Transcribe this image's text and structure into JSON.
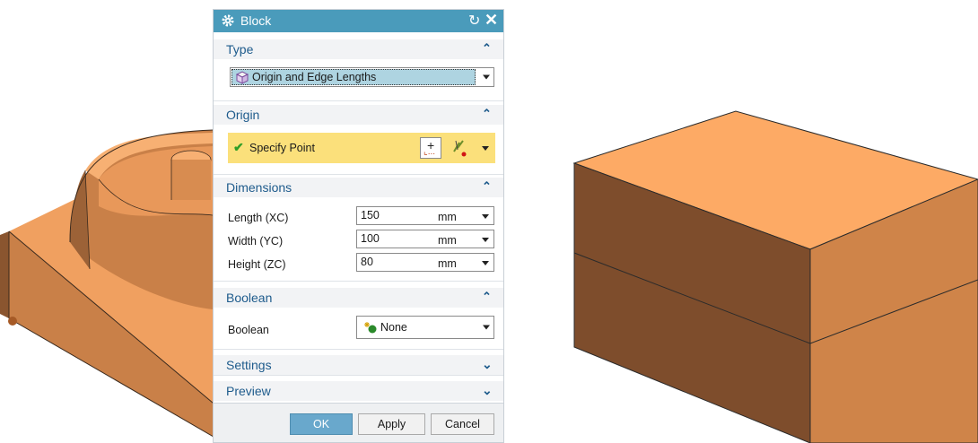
{
  "dialog": {
    "title": "Block",
    "icons": {
      "title": "gear-icon",
      "reset": "reset-icon",
      "close": "close-icon"
    },
    "type": {
      "header": "Type",
      "selected": "Origin and Edge Lengths",
      "icon": "block-icon"
    },
    "origin": {
      "header": "Origin",
      "specify": "Specify Point",
      "status_icon": "checkmark-icon"
    },
    "dimensions": {
      "header": "Dimensions",
      "rows": [
        {
          "label": "Length (XC)",
          "value": "150",
          "unit": "mm"
        },
        {
          "label": "Width (YC)",
          "value": "100",
          "unit": "mm"
        },
        {
          "label": "Height (ZC)",
          "value": "80",
          "unit": "mm"
        }
      ]
    },
    "boolean": {
      "header": "Boolean",
      "label": "Boolean",
      "value": "None",
      "icon": "boolean-none-icon"
    },
    "settings": {
      "header": "Settings"
    },
    "preview": {
      "header": "Preview"
    },
    "buttons": {
      "ok": "OK",
      "apply": "Apply",
      "cancel": "Cancel"
    }
  },
  "colors": {
    "title_bar": "#4a9bbb",
    "section_text": "#1e5b8c",
    "highlight": "#fbe07b",
    "selected_row": "#aed4e1",
    "ok_button": "#69a8cc",
    "model_light": "#fdaa65",
    "model_mid": "#cf8449",
    "model_dark": "#7e4d2c"
  }
}
